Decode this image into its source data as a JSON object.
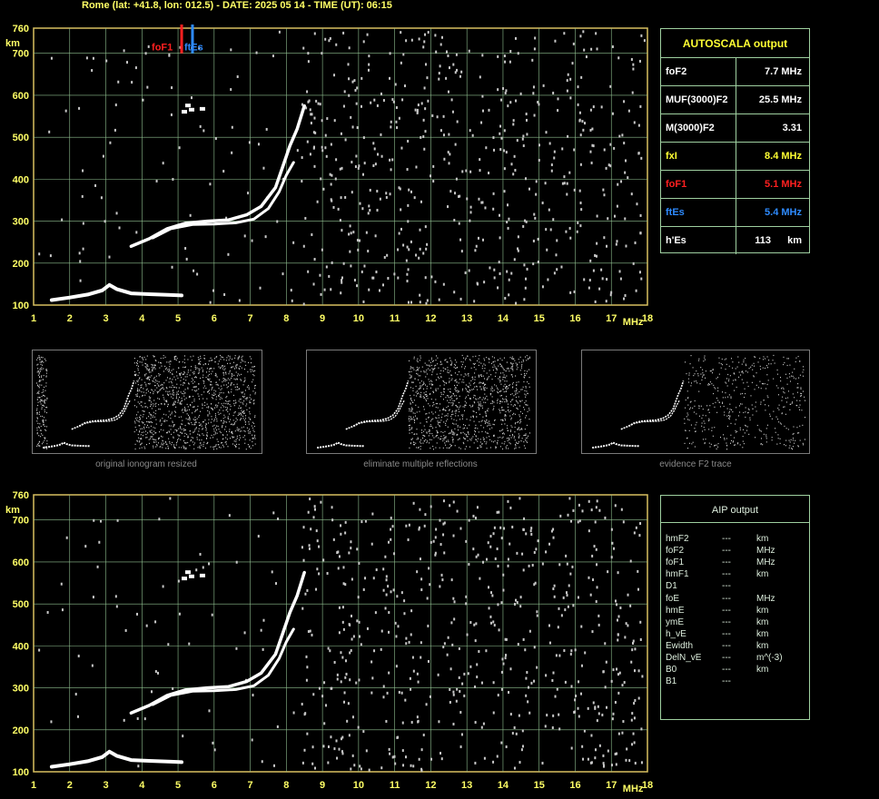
{
  "header": "Rome (lat: +41.8, lon: 012.5) - DATE: 2025 05 14 - TIME (UT): 06:15",
  "colors": {
    "grid": "#8fbf8f",
    "axis_text": "#ffff66",
    "trace": "#ffffff",
    "noise": "#c8c8c8",
    "fof1": "#ff2020",
    "ftes": "#2e8bff",
    "box_border": "#9fd0a0"
  },
  "chart_data": [
    {
      "type": "scatter",
      "title": "",
      "xlabel": "MHz",
      "ylabel": "km",
      "xlim": [
        1,
        18
      ],
      "ylim": [
        100,
        760
      ],
      "x_ticks": [
        "1",
        "2",
        "3",
        "4",
        "5",
        "6",
        "7",
        "8",
        "9",
        "10",
        "11",
        "12",
        "13",
        "14",
        "15",
        "16",
        "17",
        "18"
      ],
      "y_ticks": [
        "100",
        "200",
        "300",
        "400",
        "500",
        "600",
        "700",
        "760"
      ],
      "grid": true,
      "markers": [
        {
          "name": "foF1",
          "x": 5.1
        },
        {
          "name": "ftEs",
          "x": 5.4
        }
      ],
      "series": [
        {
          "name": "foF1",
          "points": [
            [
              5.1,
              700
            ],
            [
              5.1,
              760
            ]
          ]
        },
        {
          "name": "ftEs",
          "points": [
            [
              5.4,
              700
            ],
            [
              5.4,
              760
            ]
          ]
        }
      ]
    },
    {
      "type": "scatter",
      "title": "",
      "xlabel": "MHz",
      "ylabel": "km",
      "xlim": [
        1,
        18
      ],
      "ylim": [
        100,
        760
      ],
      "x_ticks": [
        "1",
        "2",
        "3",
        "4",
        "5",
        "6",
        "7",
        "8",
        "9",
        "10",
        "11",
        "12",
        "13",
        "14",
        "15",
        "16",
        "17",
        "18"
      ],
      "y_ticks": [
        "100",
        "200",
        "300",
        "400",
        "500",
        "600",
        "700",
        "760"
      ],
      "grid": true
    }
  ],
  "traces": {
    "es_layer": [
      [
        1.5,
        112
      ],
      [
        2.0,
        118
      ],
      [
        2.5,
        125
      ],
      [
        2.9,
        135
      ],
      [
        3.1,
        148
      ],
      [
        3.3,
        138
      ],
      [
        3.7,
        128
      ],
      [
        4.2,
        126
      ],
      [
        4.8,
        124
      ],
      [
        5.1,
        123
      ]
    ],
    "f_ordinary": [
      [
        3.7,
        240
      ],
      [
        4.2,
        258
      ],
      [
        4.7,
        282
      ],
      [
        5.2,
        295
      ],
      [
        5.8,
        300
      ],
      [
        6.4,
        303
      ],
      [
        6.9,
        315
      ],
      [
        7.3,
        335
      ],
      [
        7.7,
        380
      ],
      [
        7.9,
        430
      ],
      [
        8.1,
        480
      ],
      [
        8.3,
        520
      ],
      [
        8.5,
        575
      ]
    ],
    "f_extra": [
      [
        4.3,
        260
      ],
      [
        4.8,
        282
      ],
      [
        5.4,
        292
      ],
      [
        6.0,
        293
      ],
      [
        6.6,
        296
      ],
      [
        7.1,
        305
      ],
      [
        7.5,
        330
      ],
      [
        7.8,
        370
      ],
      [
        8.0,
        410
      ],
      [
        8.2,
        440
      ]
    ],
    "ghost": [
      [
        5.1,
        565
      ],
      [
        5.3,
        570
      ],
      [
        5.6,
        572
      ],
      [
        5.2,
        580
      ]
    ]
  },
  "autoscala": {
    "title": "AUTOSCALA output",
    "rows": [
      {
        "label": "foF2",
        "value": "7.7 MHz",
        "color": "#ffffff"
      },
      {
        "label": "MUF(3000)F2",
        "value": "25.5 MHz",
        "color": "#ffffff"
      },
      {
        "label": "M(3000)F2",
        "value": "3.31",
        "color": "#ffffff"
      },
      {
        "label": "fxI",
        "value": "8.4 MHz",
        "color": "#ffff33"
      },
      {
        "label": "foF1",
        "value": "5.1 MHz",
        "color": "#ff2020"
      },
      {
        "label": "ftEs",
        "value": "5.4 MHz",
        "color": "#2e8bff"
      },
      {
        "label": "h'Es",
        "value": "113",
        "unit": "km",
        "color": "#ffffff"
      }
    ]
  },
  "aip": {
    "title": "AIP output",
    "rows": [
      {
        "name": "hmF2",
        "value": "---",
        "unit": "km"
      },
      {
        "name": "foF2",
        "value": "---",
        "unit": "MHz"
      },
      {
        "name": "foF1",
        "value": "---",
        "unit": "MHz"
      },
      {
        "name": "hmF1",
        "value": "---",
        "unit": "km"
      },
      {
        "name": "D1",
        "value": "---",
        "unit": ""
      },
      {
        "name": "foE",
        "value": "---",
        "unit": "MHz"
      },
      {
        "name": "hmE",
        "value": "---",
        "unit": "km"
      },
      {
        "name": "ymE",
        "value": "---",
        "unit": "km"
      },
      {
        "name": "h_vE",
        "value": "---",
        "unit": "km"
      },
      {
        "name": "Ewidth",
        "value": "---",
        "unit": "km"
      },
      {
        "name": "DelN_vE",
        "value": "---",
        "unit": "m^(-3)"
      },
      {
        "name": "B0",
        "value": "---",
        "unit": "km"
      },
      {
        "name": "B1",
        "value": "---",
        "unit": ""
      }
    ]
  },
  "thumbnails": [
    {
      "caption": "original ionogram resized"
    },
    {
      "caption": "eliminate multiple reflections"
    },
    {
      "caption": "evidence F2 trace"
    }
  ]
}
